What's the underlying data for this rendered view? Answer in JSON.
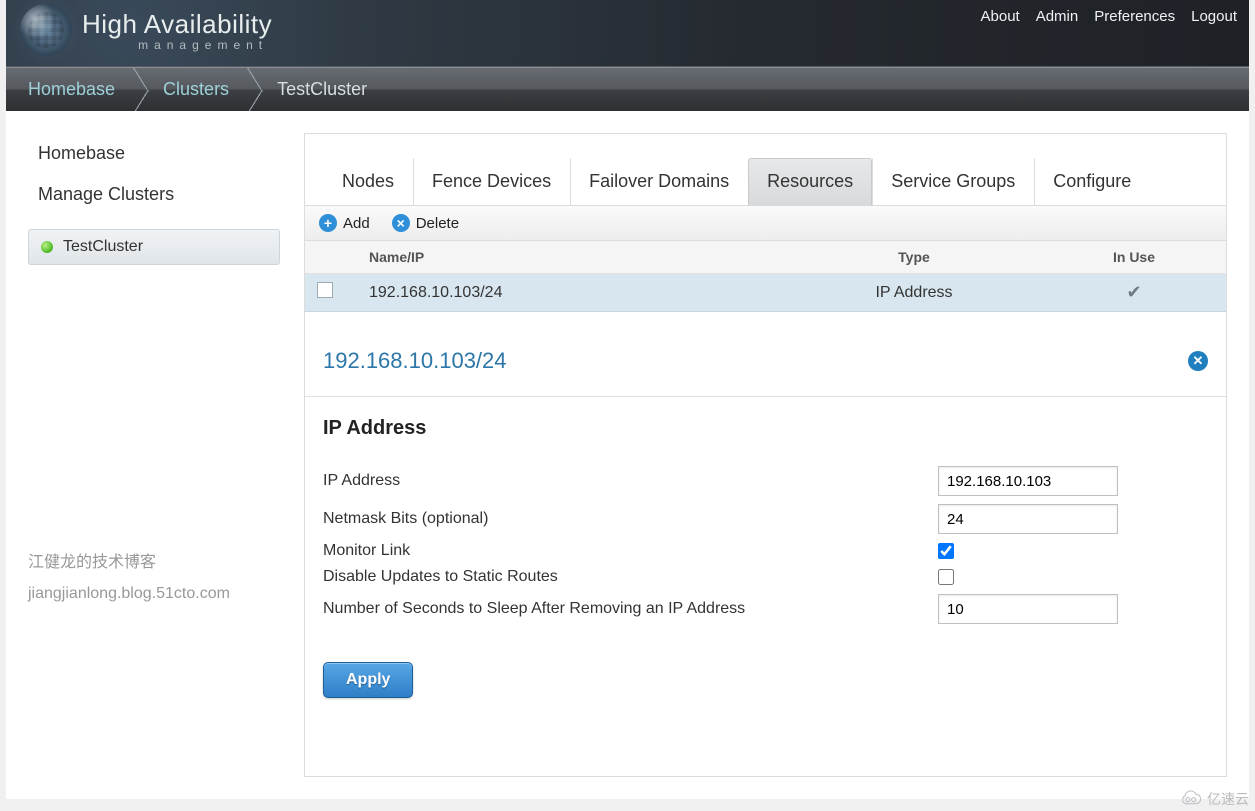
{
  "header": {
    "brand_main": "High Availability",
    "brand_sub": "management",
    "links": {
      "about": "About",
      "admin": "Admin",
      "preferences": "Preferences",
      "logout": "Logout"
    }
  },
  "breadcrumb": {
    "home": "Homebase",
    "clusters": "Clusters",
    "current": "TestCluster"
  },
  "sidebar": {
    "homebase": "Homebase",
    "manage": "Manage Clusters",
    "cluster_item": "TestCluster"
  },
  "watermark": {
    "line1": "江健龙的技术博客",
    "line2": "jiangjianlong.blog.51cto.com"
  },
  "tabs": {
    "nodes": "Nodes",
    "fence": "Fence Devices",
    "failover": "Failover Domains",
    "resources": "Resources",
    "svc": "Service Groups",
    "configure": "Configure"
  },
  "toolbar": {
    "add": "Add",
    "delete": "Delete"
  },
  "grid": {
    "head": {
      "name": "Name/IP",
      "type": "Type",
      "inuse": "In Use"
    },
    "row": {
      "name": "192.168.10.103/24",
      "type": "IP Address"
    }
  },
  "detail": {
    "title": "192.168.10.103/24",
    "section": "IP Address",
    "fields": {
      "ip_label": "IP Address",
      "ip_value": "192.168.10.103",
      "mask_label": "Netmask Bits (optional)",
      "mask_value": "24",
      "monitor_label": "Monitor Link",
      "disable_label": "Disable Updates to Static Routes",
      "sleep_label": "Number of Seconds to Sleep After Removing an IP Address",
      "sleep_value": "10"
    },
    "apply": "Apply"
  },
  "yisu": "亿速云"
}
